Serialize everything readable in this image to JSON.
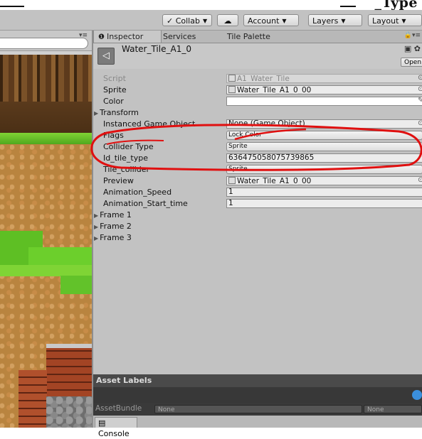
{
  "toolbar": {
    "collab": "Collab",
    "account": "Account",
    "layers": "Layers",
    "layout": "Layout",
    "cloud_icon": "cloud-icon",
    "cut_heading": "_Type"
  },
  "tabs": {
    "inspector": "Inspector",
    "services": "Services",
    "tile_palette": "Tile Palette"
  },
  "header": {
    "object_name": "Water_Tile_A1_0",
    "open_label": "Open"
  },
  "fields": [
    {
      "label": "Script",
      "value": "A1_Water_Tile",
      "disabled": true
    },
    {
      "label": "Sprite",
      "value": "Water_Tile_A1_0_00"
    },
    {
      "label": "Color",
      "value": ""
    },
    {
      "label": "Transform",
      "value": ""
    },
    {
      "label": "Instanced Game Object",
      "value": "None (Game Object)"
    },
    {
      "label": "Flags",
      "value": "Lock Color"
    },
    {
      "label": "Collider Type",
      "value": "Sprite"
    },
    {
      "label": "Id_tile_type",
      "value": "636475058075739865"
    },
    {
      "label": "Tile_collider",
      "value": "Sprite"
    },
    {
      "label": "Preview",
      "value": "Water_Tile_A1_0_00"
    },
    {
      "label": "Animation_Speed",
      "value": "1"
    },
    {
      "label": "Animation_Start_time",
      "value": "1"
    },
    {
      "label": "Frame 1",
      "value": ""
    },
    {
      "label": "Frame 2",
      "value": ""
    },
    {
      "label": "Frame 3",
      "value": ""
    }
  ],
  "asset_labels": {
    "title": "Asset Labels",
    "bundle_label": "AssetBundle",
    "bundle_value": "None",
    "variant_value": "None"
  },
  "bottom": {
    "console": "Console"
  },
  "colors": {
    "panel_bg": "#c2c2c2",
    "annotation": "#e01010",
    "dark_bar": "#4a4a4a"
  }
}
